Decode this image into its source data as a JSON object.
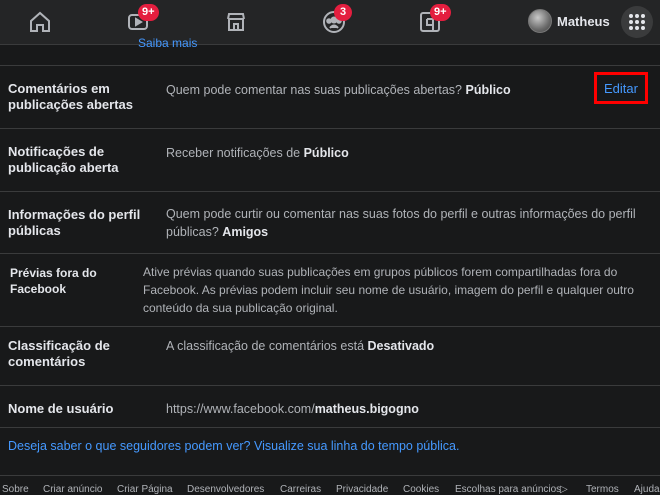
{
  "topbar": {
    "nav": [
      {
        "icon": "home-icon",
        "badge": ""
      },
      {
        "icon": "watch-icon",
        "badge": "9+"
      },
      {
        "icon": "marketplace-icon",
        "badge": ""
      },
      {
        "icon": "groups-icon",
        "badge": "3"
      },
      {
        "icon": "gaming-icon",
        "badge": "9+"
      }
    ],
    "profile_name": "Matheus",
    "menu_icon": "menu-grid-icon",
    "accent": "#e41e3f"
  },
  "cut_link": "Saiba mais",
  "rows": [
    {
      "label": "Comentários em publicações abertas",
      "desc_pre": "Quem pode comentar nas suas publicações abertas? ",
      "desc_bold": "Público",
      "action": "Editar"
    },
    {
      "label": "Notificações de publicação aberta",
      "desc_pre": "Receber notificações de ",
      "desc_bold": "Público"
    },
    {
      "label": "Informações do perfil públicas",
      "desc_pre": "Quem pode curtir ou comentar nas suas fotos do perfil e outras informações do perfil públicas? ",
      "desc_bold": "Amigos"
    },
    {
      "label": "Prévias fora do Facebook",
      "desc_pre": "Ative prévias quando suas publicações em grupos públicos forem compartilhadas fora do Facebook. As prévias podem incluir seu nome de usuário, imagem do perfil e qualquer outro conteúdo da sua publicação original.",
      "desc_bold": ""
    },
    {
      "label": "Classificação de comentários",
      "desc_pre": "A classificação de comentários está ",
      "desc_bold": "Desativado"
    },
    {
      "label": "Nome de usuário",
      "desc_pre": "https://www.facebook.com/",
      "desc_bold": "matheus.bigogno"
    }
  ],
  "timeline_link": "Deseja saber o que seguidores podem ver? Visualize sua linha do tempo pública.",
  "footer": [
    "Sobre",
    "Criar anúncio",
    "Criar Página",
    "Desenvolvedores",
    "Carreiras",
    "Privacidade",
    "Cookies",
    "Escolhas para anúncios",
    "Termos",
    "Ajuda"
  ],
  "colors": {
    "link": "#4599ff",
    "highlight": "#ff0000",
    "background": "#18191a"
  }
}
